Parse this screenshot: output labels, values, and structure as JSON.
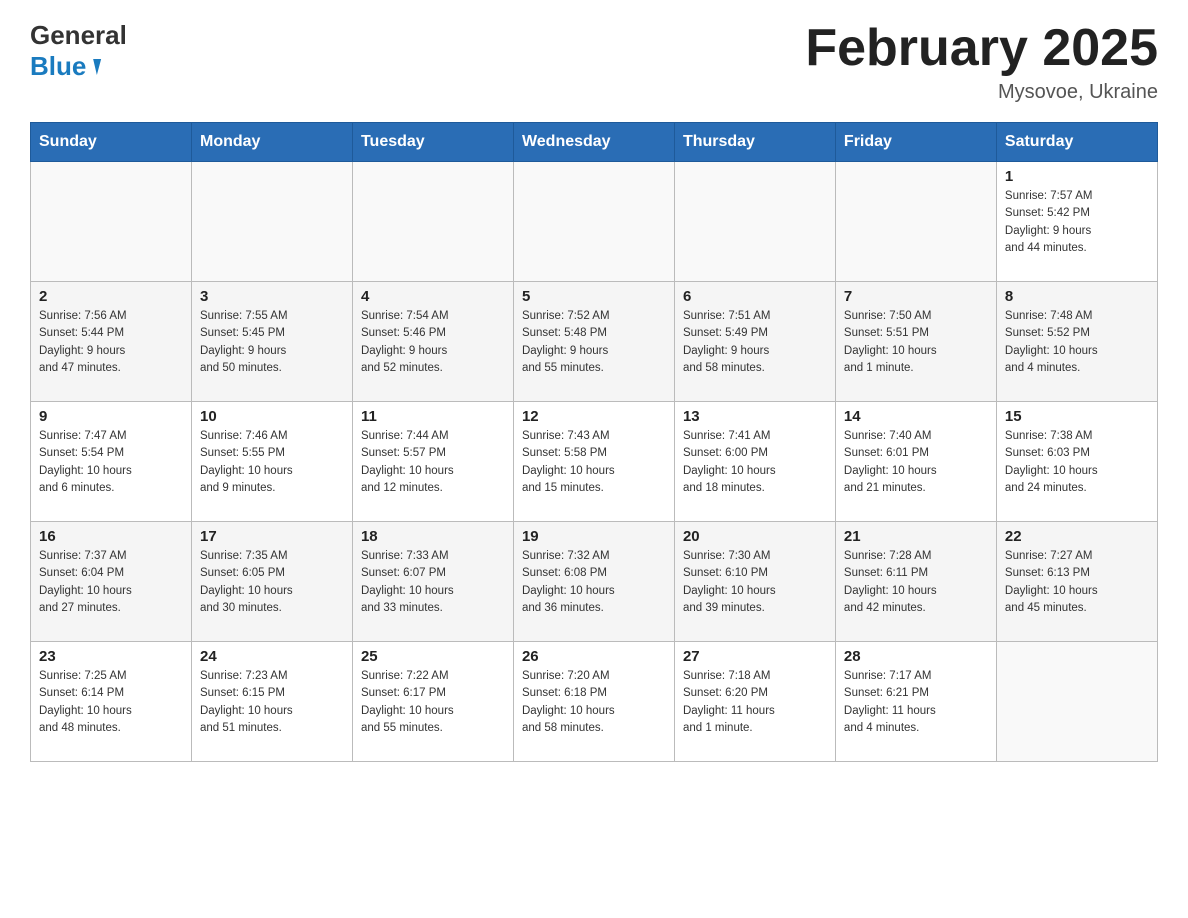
{
  "header": {
    "logo_line1": "General",
    "logo_line2": "Blue",
    "month_title": "February 2025",
    "location": "Mysovoe, Ukraine"
  },
  "calendar": {
    "days_of_week": [
      "Sunday",
      "Monday",
      "Tuesday",
      "Wednesday",
      "Thursday",
      "Friday",
      "Saturday"
    ],
    "weeks": [
      [
        {
          "day": "",
          "info": ""
        },
        {
          "day": "",
          "info": ""
        },
        {
          "day": "",
          "info": ""
        },
        {
          "day": "",
          "info": ""
        },
        {
          "day": "",
          "info": ""
        },
        {
          "day": "",
          "info": ""
        },
        {
          "day": "1",
          "info": "Sunrise: 7:57 AM\nSunset: 5:42 PM\nDaylight: 9 hours\nand 44 minutes."
        }
      ],
      [
        {
          "day": "2",
          "info": "Sunrise: 7:56 AM\nSunset: 5:44 PM\nDaylight: 9 hours\nand 47 minutes."
        },
        {
          "day": "3",
          "info": "Sunrise: 7:55 AM\nSunset: 5:45 PM\nDaylight: 9 hours\nand 50 minutes."
        },
        {
          "day": "4",
          "info": "Sunrise: 7:54 AM\nSunset: 5:46 PM\nDaylight: 9 hours\nand 52 minutes."
        },
        {
          "day": "5",
          "info": "Sunrise: 7:52 AM\nSunset: 5:48 PM\nDaylight: 9 hours\nand 55 minutes."
        },
        {
          "day": "6",
          "info": "Sunrise: 7:51 AM\nSunset: 5:49 PM\nDaylight: 9 hours\nand 58 minutes."
        },
        {
          "day": "7",
          "info": "Sunrise: 7:50 AM\nSunset: 5:51 PM\nDaylight: 10 hours\nand 1 minute."
        },
        {
          "day": "8",
          "info": "Sunrise: 7:48 AM\nSunset: 5:52 PM\nDaylight: 10 hours\nand 4 minutes."
        }
      ],
      [
        {
          "day": "9",
          "info": "Sunrise: 7:47 AM\nSunset: 5:54 PM\nDaylight: 10 hours\nand 6 minutes."
        },
        {
          "day": "10",
          "info": "Sunrise: 7:46 AM\nSunset: 5:55 PM\nDaylight: 10 hours\nand 9 minutes."
        },
        {
          "day": "11",
          "info": "Sunrise: 7:44 AM\nSunset: 5:57 PM\nDaylight: 10 hours\nand 12 minutes."
        },
        {
          "day": "12",
          "info": "Sunrise: 7:43 AM\nSunset: 5:58 PM\nDaylight: 10 hours\nand 15 minutes."
        },
        {
          "day": "13",
          "info": "Sunrise: 7:41 AM\nSunset: 6:00 PM\nDaylight: 10 hours\nand 18 minutes."
        },
        {
          "day": "14",
          "info": "Sunrise: 7:40 AM\nSunset: 6:01 PM\nDaylight: 10 hours\nand 21 minutes."
        },
        {
          "day": "15",
          "info": "Sunrise: 7:38 AM\nSunset: 6:03 PM\nDaylight: 10 hours\nand 24 minutes."
        }
      ],
      [
        {
          "day": "16",
          "info": "Sunrise: 7:37 AM\nSunset: 6:04 PM\nDaylight: 10 hours\nand 27 minutes."
        },
        {
          "day": "17",
          "info": "Sunrise: 7:35 AM\nSunset: 6:05 PM\nDaylight: 10 hours\nand 30 minutes."
        },
        {
          "day": "18",
          "info": "Sunrise: 7:33 AM\nSunset: 6:07 PM\nDaylight: 10 hours\nand 33 minutes."
        },
        {
          "day": "19",
          "info": "Sunrise: 7:32 AM\nSunset: 6:08 PM\nDaylight: 10 hours\nand 36 minutes."
        },
        {
          "day": "20",
          "info": "Sunrise: 7:30 AM\nSunset: 6:10 PM\nDaylight: 10 hours\nand 39 minutes."
        },
        {
          "day": "21",
          "info": "Sunrise: 7:28 AM\nSunset: 6:11 PM\nDaylight: 10 hours\nand 42 minutes."
        },
        {
          "day": "22",
          "info": "Sunrise: 7:27 AM\nSunset: 6:13 PM\nDaylight: 10 hours\nand 45 minutes."
        }
      ],
      [
        {
          "day": "23",
          "info": "Sunrise: 7:25 AM\nSunset: 6:14 PM\nDaylight: 10 hours\nand 48 minutes."
        },
        {
          "day": "24",
          "info": "Sunrise: 7:23 AM\nSunset: 6:15 PM\nDaylight: 10 hours\nand 51 minutes."
        },
        {
          "day": "25",
          "info": "Sunrise: 7:22 AM\nSunset: 6:17 PM\nDaylight: 10 hours\nand 55 minutes."
        },
        {
          "day": "26",
          "info": "Sunrise: 7:20 AM\nSunset: 6:18 PM\nDaylight: 10 hours\nand 58 minutes."
        },
        {
          "day": "27",
          "info": "Sunrise: 7:18 AM\nSunset: 6:20 PM\nDaylight: 11 hours\nand 1 minute."
        },
        {
          "day": "28",
          "info": "Sunrise: 7:17 AM\nSunset: 6:21 PM\nDaylight: 11 hours\nand 4 minutes."
        },
        {
          "day": "",
          "info": ""
        }
      ]
    ]
  }
}
